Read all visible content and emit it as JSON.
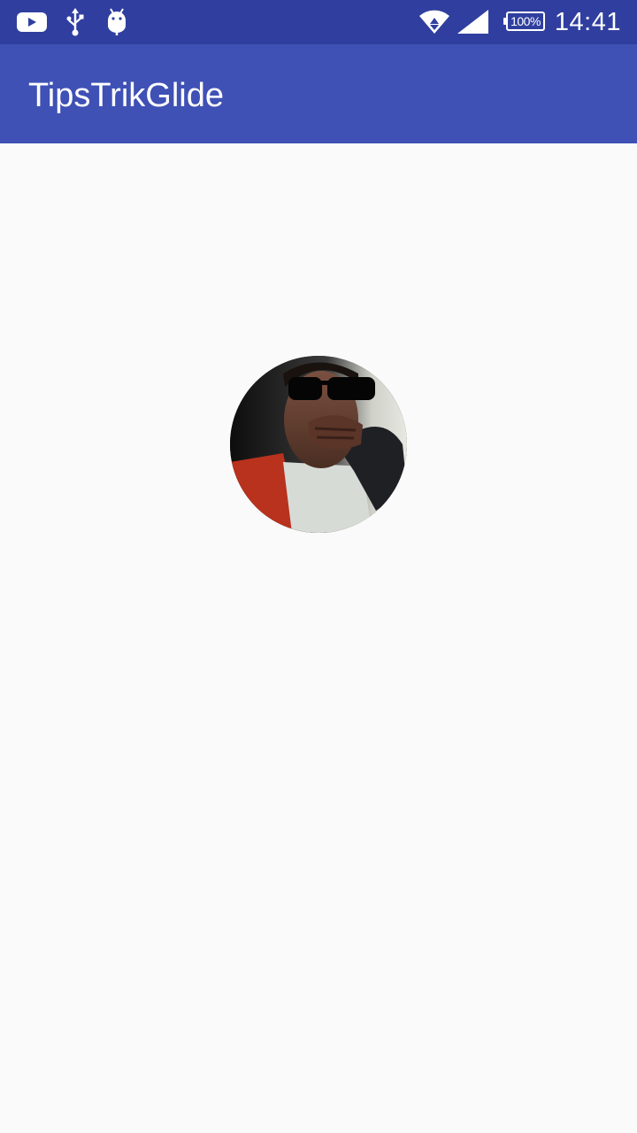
{
  "status_bar": {
    "left_icons": [
      "youtube-icon",
      "usb-icon",
      "android-debug-icon"
    ],
    "right_icons": [
      "wifi-icon",
      "signal-icon",
      "battery-icon"
    ],
    "battery_label": "100%",
    "time": "14:41",
    "bar_color": "#303f9f"
  },
  "app_bar": {
    "title": "TipsTrikGlide",
    "color": "#3f51b5"
  },
  "content": {
    "background": "#fafafa",
    "avatar": {
      "shape": "circle",
      "description_icon": "profile-photo"
    }
  }
}
